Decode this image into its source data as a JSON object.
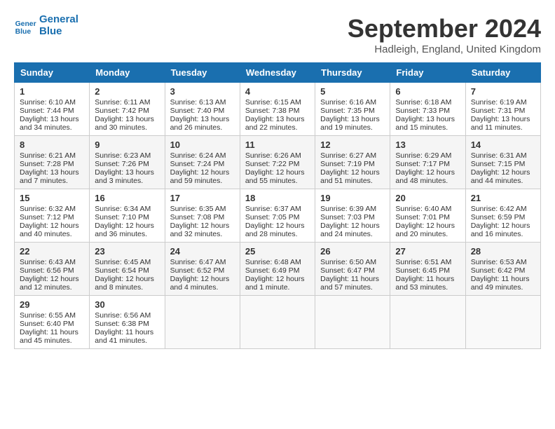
{
  "header": {
    "logo_line1": "General",
    "logo_line2": "Blue",
    "month_title": "September 2024",
    "location": "Hadleigh, England, United Kingdom"
  },
  "weekdays": [
    "Sunday",
    "Monday",
    "Tuesday",
    "Wednesday",
    "Thursday",
    "Friday",
    "Saturday"
  ],
  "weeks": [
    [
      {
        "day": "1",
        "rise": "6:10 AM",
        "set": "7:44 PM",
        "daylight": "13 hours and 34 minutes."
      },
      {
        "day": "2",
        "rise": "6:11 AM",
        "set": "7:42 PM",
        "daylight": "13 hours and 30 minutes."
      },
      {
        "day": "3",
        "rise": "6:13 AM",
        "set": "7:40 PM",
        "daylight": "13 hours and 26 minutes."
      },
      {
        "day": "4",
        "rise": "6:15 AM",
        "set": "7:38 PM",
        "daylight": "13 hours and 22 minutes."
      },
      {
        "day": "5",
        "rise": "6:16 AM",
        "set": "7:35 PM",
        "daylight": "13 hours and 19 minutes."
      },
      {
        "day": "6",
        "rise": "6:18 AM",
        "set": "7:33 PM",
        "daylight": "13 hours and 15 minutes."
      },
      {
        "day": "7",
        "rise": "6:19 AM",
        "set": "7:31 PM",
        "daylight": "13 hours and 11 minutes."
      }
    ],
    [
      {
        "day": "8",
        "rise": "6:21 AM",
        "set": "7:28 PM",
        "daylight": "13 hours and 7 minutes."
      },
      {
        "day": "9",
        "rise": "6:23 AM",
        "set": "7:26 PM",
        "daylight": "13 hours and 3 minutes."
      },
      {
        "day": "10",
        "rise": "6:24 AM",
        "set": "7:24 PM",
        "daylight": "12 hours and 59 minutes."
      },
      {
        "day": "11",
        "rise": "6:26 AM",
        "set": "7:22 PM",
        "daylight": "12 hours and 55 minutes."
      },
      {
        "day": "12",
        "rise": "6:27 AM",
        "set": "7:19 PM",
        "daylight": "12 hours and 51 minutes."
      },
      {
        "day": "13",
        "rise": "6:29 AM",
        "set": "7:17 PM",
        "daylight": "12 hours and 48 minutes."
      },
      {
        "day": "14",
        "rise": "6:31 AM",
        "set": "7:15 PM",
        "daylight": "12 hours and 44 minutes."
      }
    ],
    [
      {
        "day": "15",
        "rise": "6:32 AM",
        "set": "7:12 PM",
        "daylight": "12 hours and 40 minutes."
      },
      {
        "day": "16",
        "rise": "6:34 AM",
        "set": "7:10 PM",
        "daylight": "12 hours and 36 minutes."
      },
      {
        "day": "17",
        "rise": "6:35 AM",
        "set": "7:08 PM",
        "daylight": "12 hours and 32 minutes."
      },
      {
        "day": "18",
        "rise": "6:37 AM",
        "set": "7:05 PM",
        "daylight": "12 hours and 28 minutes."
      },
      {
        "day": "19",
        "rise": "6:39 AM",
        "set": "7:03 PM",
        "daylight": "12 hours and 24 minutes."
      },
      {
        "day": "20",
        "rise": "6:40 AM",
        "set": "7:01 PM",
        "daylight": "12 hours and 20 minutes."
      },
      {
        "day": "21",
        "rise": "6:42 AM",
        "set": "6:59 PM",
        "daylight": "12 hours and 16 minutes."
      }
    ],
    [
      {
        "day": "22",
        "rise": "6:43 AM",
        "set": "6:56 PM",
        "daylight": "12 hours and 12 minutes."
      },
      {
        "day": "23",
        "rise": "6:45 AM",
        "set": "6:54 PM",
        "daylight": "12 hours and 8 minutes."
      },
      {
        "day": "24",
        "rise": "6:47 AM",
        "set": "6:52 PM",
        "daylight": "12 hours and 4 minutes."
      },
      {
        "day": "25",
        "rise": "6:48 AM",
        "set": "6:49 PM",
        "daylight": "12 hours and 1 minute."
      },
      {
        "day": "26",
        "rise": "6:50 AM",
        "set": "6:47 PM",
        "daylight": "11 hours and 57 minutes."
      },
      {
        "day": "27",
        "rise": "6:51 AM",
        "set": "6:45 PM",
        "daylight": "11 hours and 53 minutes."
      },
      {
        "day": "28",
        "rise": "6:53 AM",
        "set": "6:42 PM",
        "daylight": "11 hours and 49 minutes."
      }
    ],
    [
      {
        "day": "29",
        "rise": "6:55 AM",
        "set": "6:40 PM",
        "daylight": "11 hours and 45 minutes."
      },
      {
        "day": "30",
        "rise": "6:56 AM",
        "set": "6:38 PM",
        "daylight": "11 hours and 41 minutes."
      },
      null,
      null,
      null,
      null,
      null
    ]
  ]
}
